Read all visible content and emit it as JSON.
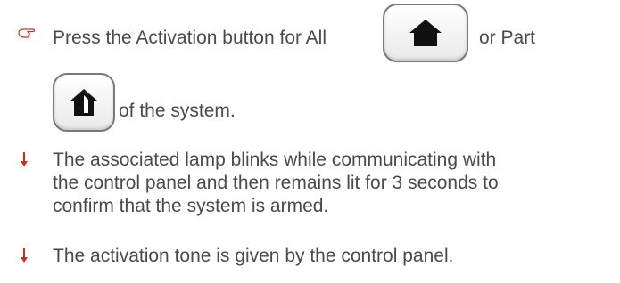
{
  "items": [
    {
      "icon": "pointing-hand-icon",
      "line1_before": "Press the Activation button for All",
      "line1_after": "or Part",
      "line2": "of the system."
    },
    {
      "icon": "red-down-arrow-icon",
      "lines": [
        "The associated lamp blinks while communicating with",
        "the control panel and then remains lit for 3 seconds to",
        "confirm that the system is armed."
      ]
    },
    {
      "icon": "red-down-arrow-icon",
      "lines": [
        "The activation tone is given by the control panel."
      ]
    }
  ],
  "colors": {
    "text": "#4a4a4a",
    "bullet_arrow": "#d9261c",
    "hand_bullet": "#c0392b",
    "button_icon": "#111111"
  }
}
